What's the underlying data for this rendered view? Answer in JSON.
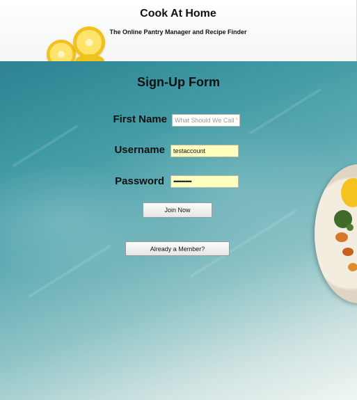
{
  "header": {
    "title": "Cook At Home",
    "tagline": "The Online Pantry Manager and Recipe Finder"
  },
  "form": {
    "title": "Sign-Up Form",
    "first_name": {
      "label": "First Name",
      "value": "",
      "placeholder": "What Should We Call You?"
    },
    "username": {
      "label": "Username",
      "value": "testaccount"
    },
    "password": {
      "label": "Password",
      "value": "••••••••••••"
    },
    "join_button": "Join Now",
    "member_button": "Already a Member?"
  }
}
